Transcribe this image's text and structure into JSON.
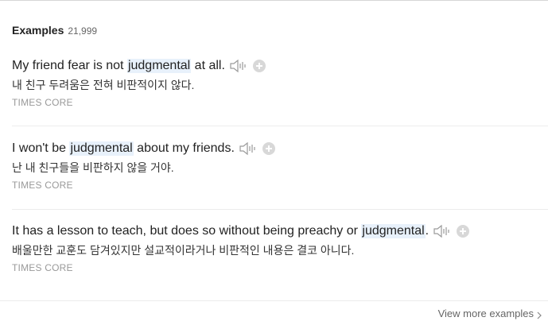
{
  "header": {
    "title": "Examples",
    "count": "21,999"
  },
  "examples": [
    {
      "pre": "My friend fear is not ",
      "keyword": "judgmental",
      "post": " at all.",
      "translation": "내 친구 두려움은 전혀 비판적이지 않다.",
      "source": "TIMES CORE"
    },
    {
      "pre": "I won't be ",
      "keyword": "judgmental",
      "post": " about my friends.",
      "translation": "난 내 친구들을 비판하지 않을 거야.",
      "source": "TIMES CORE"
    },
    {
      "pre": "It has a lesson to teach, but does so without being preachy or ",
      "keyword": "judgmental",
      "post": ".",
      "translation": "배울만한 교훈도 담겨있지만 설교적이라거나 비판적인 내용은 결코 아니다.",
      "source": "TIMES CORE"
    }
  ],
  "footer": {
    "view_more_label": "View more examples"
  },
  "icons": {
    "speaker": "speaker-icon",
    "add": "plus-circle-icon",
    "chevron": "chevron-right-icon"
  },
  "colors": {
    "highlight": "#e8f1fb",
    "icon_gray": "#9a9a9a",
    "plus_gray": "#d8d8d8"
  }
}
